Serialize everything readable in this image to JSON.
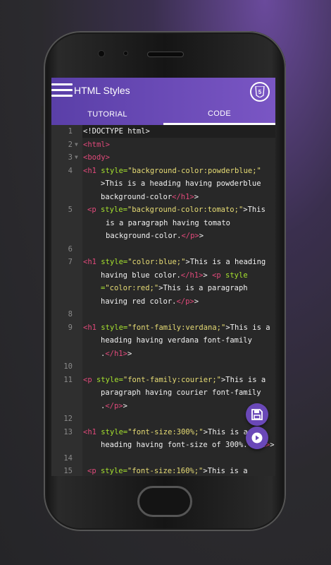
{
  "app": {
    "title": "HTML Styles",
    "logo_text": "5"
  },
  "tabs": [
    {
      "label": "TUTORIAL"
    },
    {
      "label": "CODE"
    }
  ],
  "editor": {
    "line_numbers": [
      "1",
      "2",
      "3",
      "4",
      "5",
      "6",
      "7",
      "8",
      "9",
      "10",
      "11",
      "12",
      "13",
      "14",
      "15"
    ],
    "lines": [
      {
        "parts": [
          "<!DOCTYPE html>"
        ]
      },
      {
        "parts": [
          "<html>"
        ]
      },
      {
        "parts": [
          "<body>"
        ]
      },
      {
        "parts": [
          "<h1 ",
          "style=",
          "\"background-color:powderblue;\"",
          ">This is a heading having powderblue",
          "background-color",
          "</h1>",
          ">"
        ]
      },
      {
        "parts": [
          "<p ",
          "style=",
          "\"background-color:tomato;\"",
          ">This",
          "is a paragraph having tomato",
          "background-color.",
          "</p>",
          ">"
        ]
      },
      {
        "parts": []
      },
      {
        "parts": [
          "<h1 ",
          "style=",
          "\"color:blue;\"",
          ">This is a heading",
          "having blue color.",
          "</h1>",
          "> ",
          "<p ",
          "style",
          "=",
          "\"color:red;\"",
          ">This is a paragraph",
          "having red color.",
          "</p>",
          ">"
        ]
      },
      {
        "parts": []
      },
      {
        "parts": [
          "<h1 ",
          "style=",
          "\"font-family:verdana;\"",
          ">This is a",
          "heading having verdana font-family",
          ".",
          "</h1>",
          ">"
        ]
      },
      {
        "parts": []
      },
      {
        "parts": [
          "<p ",
          "style=",
          "\"font-family:courier;\"",
          ">This is a",
          "paragraph having courier font-family",
          ".",
          "</p>",
          ">"
        ]
      },
      {
        "parts": []
      },
      {
        "parts": [
          "<h1 ",
          "style=",
          "\"font-size:300%;\"",
          ">This is a",
          "heading having font-size of 300%.",
          "</h1>",
          ">"
        ]
      },
      {
        "parts": []
      },
      {
        "parts": [
          "<p ",
          "style=",
          "\"font-size:160%;\"",
          ">This is a"
        ]
      }
    ]
  },
  "actions": {
    "save_icon": "save-icon",
    "run_icon": "play-icon"
  }
}
